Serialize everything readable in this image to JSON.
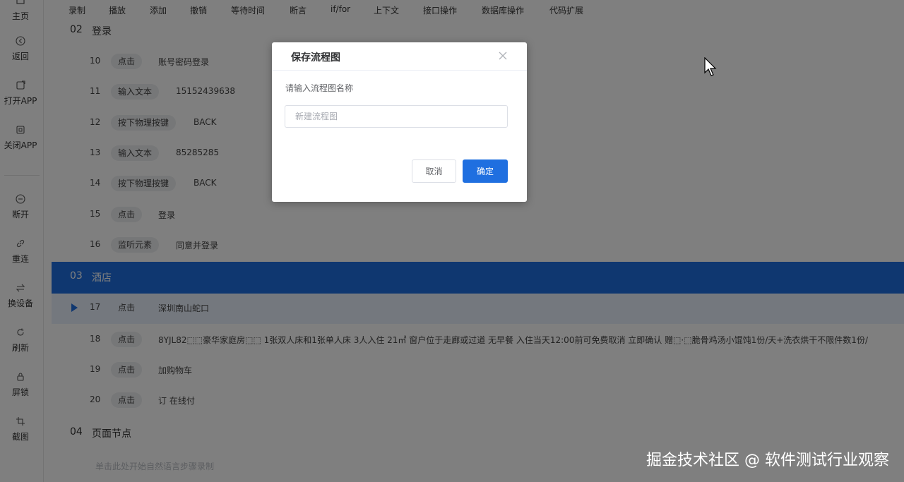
{
  "sidebar": {
    "items": [
      {
        "label": "主页",
        "icon": "home-icon"
      },
      {
        "label": "返回",
        "icon": "back-icon"
      },
      {
        "label": "打开APP",
        "icon": "open-app-icon"
      },
      {
        "label": "关闭APP",
        "icon": "close-app-icon"
      },
      {
        "label": "断开",
        "icon": "disconnect-icon"
      },
      {
        "label": "重连",
        "icon": "link-icon"
      },
      {
        "label": "换设备",
        "icon": "switch-icon"
      },
      {
        "label": "刷新",
        "icon": "refresh-icon"
      },
      {
        "label": "屏锁",
        "icon": "lock-icon"
      },
      {
        "label": "截图",
        "icon": "crop-icon"
      }
    ]
  },
  "toolbar": {
    "items": [
      "录制",
      "播放",
      "添加",
      "撤销",
      "等待时间",
      "断言",
      "if/for",
      "上下文",
      "接口操作",
      "数据库操作",
      "代码扩展"
    ]
  },
  "sections": [
    {
      "num": "02",
      "title": "登录"
    },
    {
      "num": "03",
      "title": "酒店"
    },
    {
      "num": "04",
      "title": "页面节点"
    }
  ],
  "steps": [
    {
      "no": "10",
      "action": "点击",
      "value": "账号密码登录"
    },
    {
      "no": "11",
      "action": "输入文本",
      "value": "15152439638"
    },
    {
      "no": "12",
      "action": "按下物理按键",
      "value": "BACK"
    },
    {
      "no": "13",
      "action": "输入文本",
      "value": "85285285"
    },
    {
      "no": "14",
      "action": "按下物理按键",
      "value": "BACK"
    },
    {
      "no": "15",
      "action": "点击",
      "value": "登录"
    },
    {
      "no": "16",
      "action": "监听元素",
      "value": "同意并登录"
    },
    {
      "no": "17",
      "action": "点击",
      "value": "深圳南山蛇口"
    },
    {
      "no": "18",
      "action": "点击",
      "value": "8YJL82⬚⬚豪华家庭房⬚⬚ 1张双人床和1张单人床 3人入住 21㎡ 窗户位于走廊或过道 无早餐 入住当天12:00前可免费取消 立即确认 赠⬚·⬚脆骨鸡汤小馄饨1份/天+洗衣烘干不限件数1份/"
    },
    {
      "no": "19",
      "action": "点击",
      "value": "加购物车"
    },
    {
      "no": "20",
      "action": "点击",
      "value": "订 在线付"
    }
  ],
  "hint": "单击此处开始自然语言步骤录制",
  "dialog": {
    "title": "保存流程图",
    "label": "请输入流程图名称",
    "input_placeholder": "新建流程图",
    "cancel_label": "取消",
    "ok_label": "确定"
  },
  "colors": {
    "accent": "#1f6fe0",
    "overlay": "rgba(0,0,0,0.5)"
  },
  "watermark": "掘金技术社区 @ 软件测试行业观察"
}
